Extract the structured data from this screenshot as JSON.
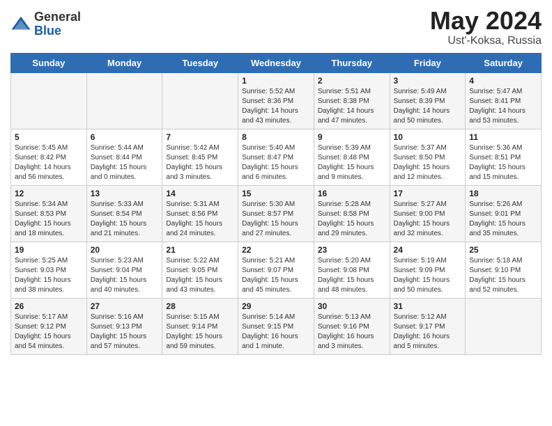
{
  "logo": {
    "general": "General",
    "blue": "Blue"
  },
  "title": {
    "month_year": "May 2024",
    "location": "Ust'-Koksa, Russia"
  },
  "days_of_week": [
    "Sunday",
    "Monday",
    "Tuesday",
    "Wednesday",
    "Thursday",
    "Friday",
    "Saturday"
  ],
  "weeks": [
    [
      {
        "day": "",
        "sunrise": "",
        "sunset": "",
        "daylight": ""
      },
      {
        "day": "",
        "sunrise": "",
        "sunset": "",
        "daylight": ""
      },
      {
        "day": "",
        "sunrise": "",
        "sunset": "",
        "daylight": ""
      },
      {
        "day": "1",
        "sunrise": "Sunrise: 5:52 AM",
        "sunset": "Sunset: 8:36 PM",
        "daylight": "Daylight: 14 hours and 43 minutes."
      },
      {
        "day": "2",
        "sunrise": "Sunrise: 5:51 AM",
        "sunset": "Sunset: 8:38 PM",
        "daylight": "Daylight: 14 hours and 47 minutes."
      },
      {
        "day": "3",
        "sunrise": "Sunrise: 5:49 AM",
        "sunset": "Sunset: 8:39 PM",
        "daylight": "Daylight: 14 hours and 50 minutes."
      },
      {
        "day": "4",
        "sunrise": "Sunrise: 5:47 AM",
        "sunset": "Sunset: 8:41 PM",
        "daylight": "Daylight: 14 hours and 53 minutes."
      }
    ],
    [
      {
        "day": "5",
        "sunrise": "Sunrise: 5:45 AM",
        "sunset": "Sunset: 8:42 PM",
        "daylight": "Daylight: 14 hours and 56 minutes."
      },
      {
        "day": "6",
        "sunrise": "Sunrise: 5:44 AM",
        "sunset": "Sunset: 8:44 PM",
        "daylight": "Daylight: 15 hours and 0 minutes."
      },
      {
        "day": "7",
        "sunrise": "Sunrise: 5:42 AM",
        "sunset": "Sunset: 8:45 PM",
        "daylight": "Daylight: 15 hours and 3 minutes."
      },
      {
        "day": "8",
        "sunrise": "Sunrise: 5:40 AM",
        "sunset": "Sunset: 8:47 PM",
        "daylight": "Daylight: 15 hours and 6 minutes."
      },
      {
        "day": "9",
        "sunrise": "Sunrise: 5:39 AM",
        "sunset": "Sunset: 8:48 PM",
        "daylight": "Daylight: 15 hours and 9 minutes."
      },
      {
        "day": "10",
        "sunrise": "Sunrise: 5:37 AM",
        "sunset": "Sunset: 8:50 PM",
        "daylight": "Daylight: 15 hours and 12 minutes."
      },
      {
        "day": "11",
        "sunrise": "Sunrise: 5:36 AM",
        "sunset": "Sunset: 8:51 PM",
        "daylight": "Daylight: 15 hours and 15 minutes."
      }
    ],
    [
      {
        "day": "12",
        "sunrise": "Sunrise: 5:34 AM",
        "sunset": "Sunset: 8:53 PM",
        "daylight": "Daylight: 15 hours and 18 minutes."
      },
      {
        "day": "13",
        "sunrise": "Sunrise: 5:33 AM",
        "sunset": "Sunset: 8:54 PM",
        "daylight": "Daylight: 15 hours and 21 minutes."
      },
      {
        "day": "14",
        "sunrise": "Sunrise: 5:31 AM",
        "sunset": "Sunset: 8:56 PM",
        "daylight": "Daylight: 15 hours and 24 minutes."
      },
      {
        "day": "15",
        "sunrise": "Sunrise: 5:30 AM",
        "sunset": "Sunset: 8:57 PM",
        "daylight": "Daylight: 15 hours and 27 minutes."
      },
      {
        "day": "16",
        "sunrise": "Sunrise: 5:28 AM",
        "sunset": "Sunset: 8:58 PM",
        "daylight": "Daylight: 15 hours and 29 minutes."
      },
      {
        "day": "17",
        "sunrise": "Sunrise: 5:27 AM",
        "sunset": "Sunset: 9:00 PM",
        "daylight": "Daylight: 15 hours and 32 minutes."
      },
      {
        "day": "18",
        "sunrise": "Sunrise: 5:26 AM",
        "sunset": "Sunset: 9:01 PM",
        "daylight": "Daylight: 15 hours and 35 minutes."
      }
    ],
    [
      {
        "day": "19",
        "sunrise": "Sunrise: 5:25 AM",
        "sunset": "Sunset: 9:03 PM",
        "daylight": "Daylight: 15 hours and 38 minutes."
      },
      {
        "day": "20",
        "sunrise": "Sunrise: 5:23 AM",
        "sunset": "Sunset: 9:04 PM",
        "daylight": "Daylight: 15 hours and 40 minutes."
      },
      {
        "day": "21",
        "sunrise": "Sunrise: 5:22 AM",
        "sunset": "Sunset: 9:05 PM",
        "daylight": "Daylight: 15 hours and 43 minutes."
      },
      {
        "day": "22",
        "sunrise": "Sunrise: 5:21 AM",
        "sunset": "Sunset: 9:07 PM",
        "daylight": "Daylight: 15 hours and 45 minutes."
      },
      {
        "day": "23",
        "sunrise": "Sunrise: 5:20 AM",
        "sunset": "Sunset: 9:08 PM",
        "daylight": "Daylight: 15 hours and 48 minutes."
      },
      {
        "day": "24",
        "sunrise": "Sunrise: 5:19 AM",
        "sunset": "Sunset: 9:09 PM",
        "daylight": "Daylight: 15 hours and 50 minutes."
      },
      {
        "day": "25",
        "sunrise": "Sunrise: 5:18 AM",
        "sunset": "Sunset: 9:10 PM",
        "daylight": "Daylight: 15 hours and 52 minutes."
      }
    ],
    [
      {
        "day": "26",
        "sunrise": "Sunrise: 5:17 AM",
        "sunset": "Sunset: 9:12 PM",
        "daylight": "Daylight: 15 hours and 54 minutes."
      },
      {
        "day": "27",
        "sunrise": "Sunrise: 5:16 AM",
        "sunset": "Sunset: 9:13 PM",
        "daylight": "Daylight: 15 hours and 57 minutes."
      },
      {
        "day": "28",
        "sunrise": "Sunrise: 5:15 AM",
        "sunset": "Sunset: 9:14 PM",
        "daylight": "Daylight: 15 hours and 59 minutes."
      },
      {
        "day": "29",
        "sunrise": "Sunrise: 5:14 AM",
        "sunset": "Sunset: 9:15 PM",
        "daylight": "Daylight: 16 hours and 1 minute."
      },
      {
        "day": "30",
        "sunrise": "Sunrise: 5:13 AM",
        "sunset": "Sunset: 9:16 PM",
        "daylight": "Daylight: 16 hours and 3 minutes."
      },
      {
        "day": "31",
        "sunrise": "Sunrise: 5:12 AM",
        "sunset": "Sunset: 9:17 PM",
        "daylight": "Daylight: 16 hours and 5 minutes."
      },
      {
        "day": "",
        "sunrise": "",
        "sunset": "",
        "daylight": ""
      }
    ]
  ]
}
